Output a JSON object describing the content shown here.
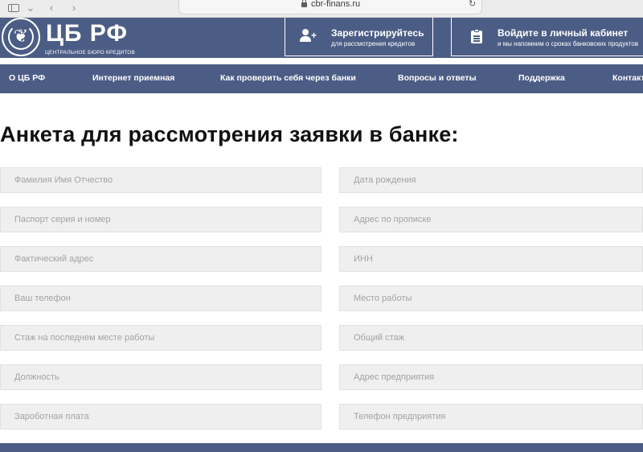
{
  "browser": {
    "url": "cbr-finans.ru",
    "back_symbol": "‹",
    "forward_symbol": "›",
    "sidebar_chevron": "⌄",
    "reload_symbol": "↻"
  },
  "header": {
    "logo_title": "ЦБ РФ",
    "logo_subtitle": "ЦЕНТРАЛЬНОЕ БЮРО КРЕДИТОВ",
    "logo_symbol": "❦",
    "register": {
      "title": "Зарегистрируйтесь",
      "subtitle": "для рассмотрения кредитов",
      "icon": "user-plus-icon"
    },
    "cabinet": {
      "title": "Войдите в личный кабинет",
      "subtitle": "и мы напомним о сроках банковских продуктов",
      "icon": "clipboard-icon"
    },
    "background_color": "#4c5d85"
  },
  "nav": {
    "items": [
      {
        "label": "О ЦБ РФ"
      },
      {
        "label": "Интернет приемная"
      },
      {
        "label": "Как проверить себя через банки"
      },
      {
        "label": "Вопросы и ответы"
      },
      {
        "label": "Поддержка"
      },
      {
        "label": "Контакты"
      }
    ]
  },
  "form": {
    "title": "Анкета для рассмотрения заявки в банке:",
    "left_fields": [
      {
        "placeholder": "Фамилия Имя Отчество"
      },
      {
        "placeholder": "Паспорт серия и номер"
      },
      {
        "placeholder": "Фактический адрес"
      },
      {
        "placeholder": "Ваш телефон"
      },
      {
        "placeholder": "Стаж на последнем месте работы"
      },
      {
        "placeholder": "Должность"
      },
      {
        "placeholder": "Зароботная плата"
      }
    ],
    "right_fields": [
      {
        "placeholder": "Дата рождения"
      },
      {
        "placeholder": "Адрес по прописке"
      },
      {
        "placeholder": "ИНН"
      },
      {
        "placeholder": "Место работы"
      },
      {
        "placeholder": "Общий стаж"
      },
      {
        "placeholder": "Адрес предприятия"
      },
      {
        "placeholder": "Телефон предприятия"
      }
    ]
  }
}
